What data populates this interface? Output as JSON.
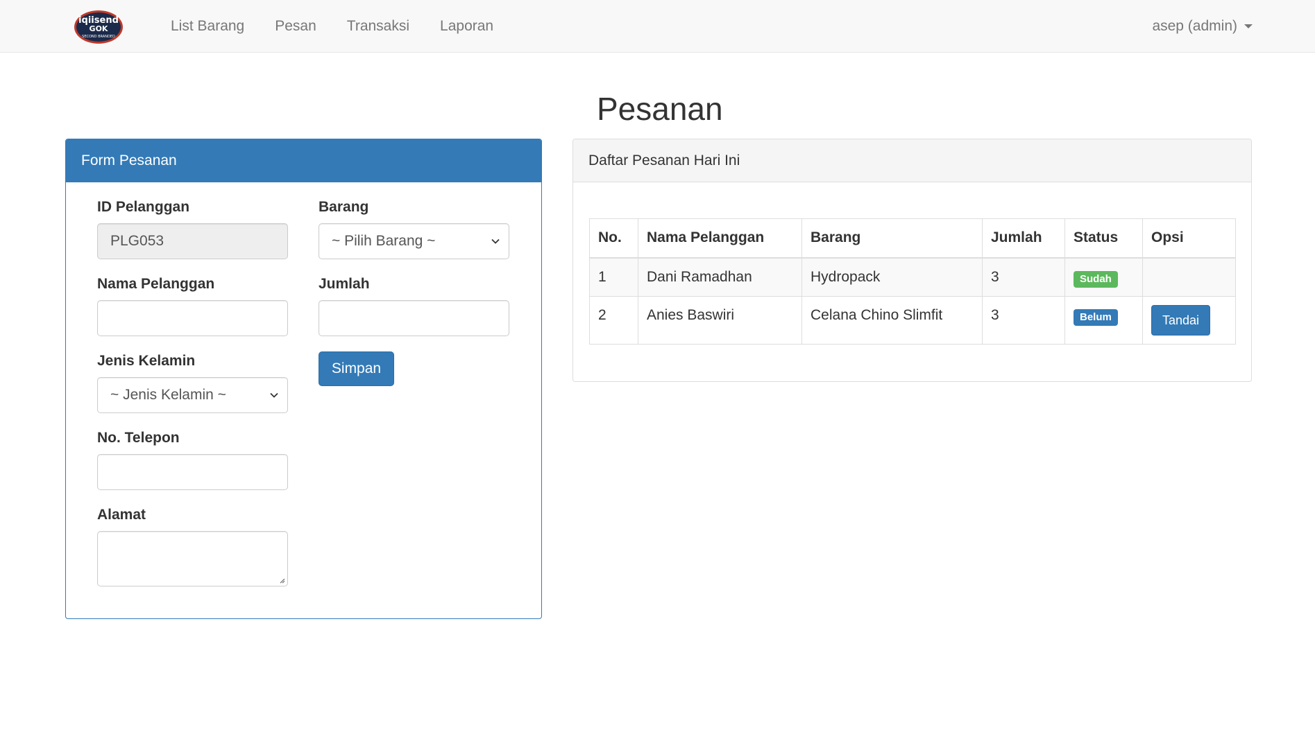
{
  "navbar": {
    "brand": {
      "top_text": "iqiisend",
      "middle_text": "GOK",
      "bottom_text": "SECOND BRANDED"
    },
    "links": [
      "List Barang",
      "Pesan",
      "Transaksi",
      "Laporan"
    ],
    "user_label": "asep (admin)"
  },
  "page": {
    "title": "Pesanan"
  },
  "form": {
    "heading": "Form Pesanan",
    "id_label": "ID Pelanggan",
    "id_value": "PLG053",
    "nama_label": "Nama Pelanggan",
    "nama_value": "",
    "kelamin_label": "Jenis Kelamin",
    "kelamin_selected": "~ Jenis Kelamin ~",
    "telepon_label": "No. Telepon",
    "telepon_value": "",
    "alamat_label": "Alamat",
    "alamat_value": "",
    "barang_label": "Barang",
    "barang_selected": "~ Pilih Barang ~",
    "jumlah_label": "Jumlah",
    "jumlah_value": "",
    "submit_label": "Simpan"
  },
  "orders": {
    "heading": "Daftar Pesanan Hari Ini",
    "columns": [
      "No.",
      "Nama Pelanggan",
      "Barang",
      "Jumlah",
      "Status",
      "Opsi"
    ],
    "rows": [
      {
        "no": "1",
        "nama": "Dani Ramadhan",
        "barang": "Hydropack",
        "jumlah": "3",
        "status": "Sudah",
        "opsi": ""
      },
      {
        "no": "2",
        "nama": "Anies Baswiri",
        "barang": "Celana Chino Slimfit",
        "jumlah": "3",
        "status": "Belum",
        "opsi": "Tandai"
      }
    ]
  },
  "colors": {
    "primary": "#337ab7",
    "success": "#5cb85c",
    "navbar_bg": "#f8f8f8",
    "readonly_bg": "#eeeeee"
  }
}
